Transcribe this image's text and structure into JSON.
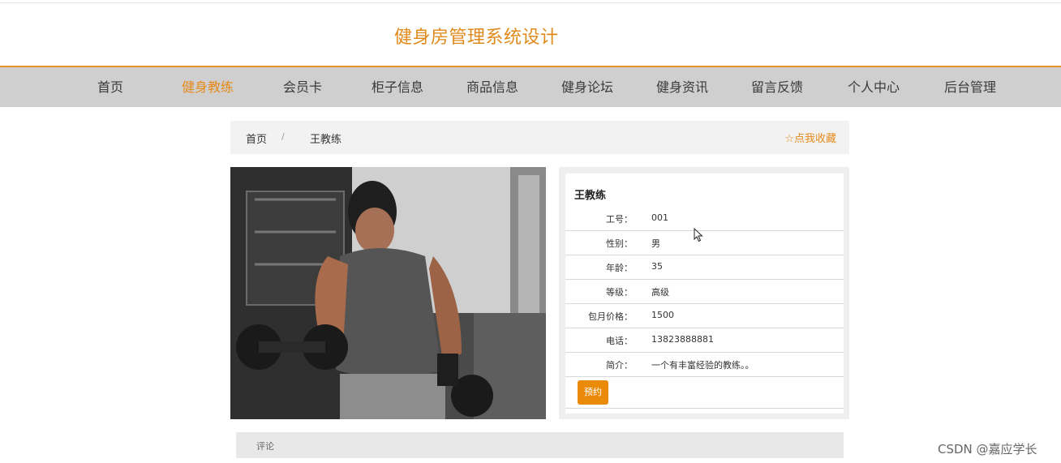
{
  "site": {
    "title": "健身房管理系统设计"
  },
  "nav": {
    "items": [
      {
        "label": "首页"
      },
      {
        "label": "健身教练"
      },
      {
        "label": "会员卡"
      },
      {
        "label": "柜子信息"
      },
      {
        "label": "商品信息"
      },
      {
        "label": "健身论坛"
      },
      {
        "label": "健身资讯"
      },
      {
        "label": "留言反馈"
      },
      {
        "label": "个人中心"
      },
      {
        "label": "后台管理"
      }
    ],
    "active_color": "#e68a1a"
  },
  "breadcrumb": {
    "home": "首页",
    "separator": "/",
    "current": "王教练",
    "favorite": "☆点我收藏"
  },
  "coach": {
    "name": "王教练",
    "fields": [
      {
        "label": "工号：",
        "value": "001"
      },
      {
        "label": "性别：",
        "value": "男"
      },
      {
        "label": "年龄：",
        "value": "35"
      },
      {
        "label": "等级：",
        "value": "高级"
      },
      {
        "label": "包月价格：",
        "value": "1500"
      },
      {
        "label": "电话：",
        "value": "13823888881"
      },
      {
        "label": "简介：",
        "value": "一个有丰富经验的教练。。"
      }
    ],
    "book_label": "预约"
  },
  "comments": {
    "label": "评论"
  },
  "watermark": "CSDN @嘉应学长",
  "colors": {
    "accent": "#e68a1a",
    "button": "#ea8a0b"
  }
}
